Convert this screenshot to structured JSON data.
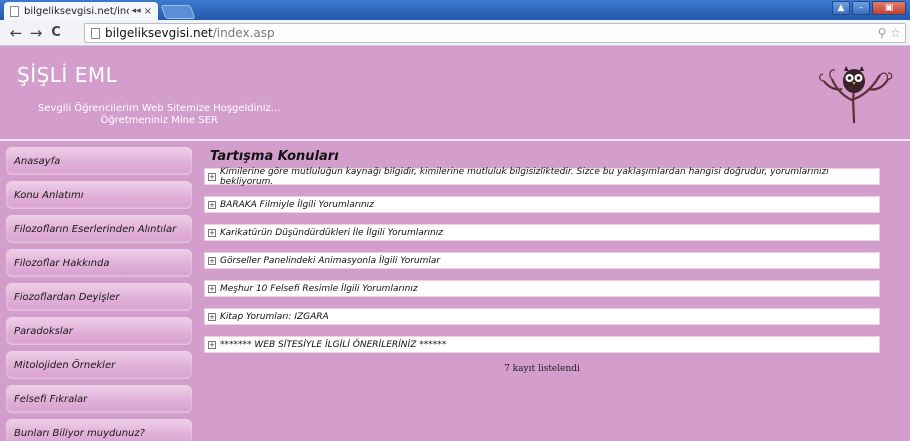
{
  "browser": {
    "tab_title": "bilgeliksevgisi.net/inc",
    "tab_audio": "◂◂",
    "tab_close": "×",
    "url_host": "bilgeliksevgisi.net",
    "url_path": "/index.asp",
    "back": "←",
    "forward": "→",
    "reload": "C"
  },
  "header": {
    "site_title": "ŞİŞLİ EML",
    "welcome_line1": "Sevgili Öğrencilerim Web Sitemize Hoşgeldiniz...",
    "welcome_line2": "Öğretmeniniz Mine SER"
  },
  "sidebar": {
    "items": [
      {
        "label": "Anasayfa"
      },
      {
        "label": "Konu Anlatımı"
      },
      {
        "label": "Filozofların Eserlerinden Alıntılar"
      },
      {
        "label": "Filozoflar Hakkında"
      },
      {
        "label": "Fiozoflardan Deyişler"
      },
      {
        "label": "Paradokslar"
      },
      {
        "label": "Mitolojiden Örnekler"
      },
      {
        "label": "Felsefi Fıkralar"
      },
      {
        "label": "Bunları Biliyor muydunuz?"
      }
    ]
  },
  "content": {
    "title": "Tartışma Konuları",
    "topics": [
      {
        "label": "Kimilerine göre mutluluğun kaynağı bilgidir, kimilerine mutluluk bilgisizliktedir. Sizce bu yaklaşımlardan hangisi doğrudur, yorumlarınızı bekliyorum."
      },
      {
        "label": "BARAKA Filmiyle İlgili Yorumlarınız"
      },
      {
        "label": "Karikatürün Düşündürdükleri İle İlgili Yorumlarınız"
      },
      {
        "label": "Görseller Panelindeki Animasyonla İlgili Yorumlar"
      },
      {
        "label": "Meşhur 10 Felsefi Resimle İlgili Yorumlarınız"
      },
      {
        "label": "Kitap Yorumları: IZGARA"
      },
      {
        "label": "******* WEB SİTESİYLE İLGİLİ ÖNERİLERİNİZ ******"
      }
    ],
    "record_count": "7 kayıt listelendi"
  }
}
